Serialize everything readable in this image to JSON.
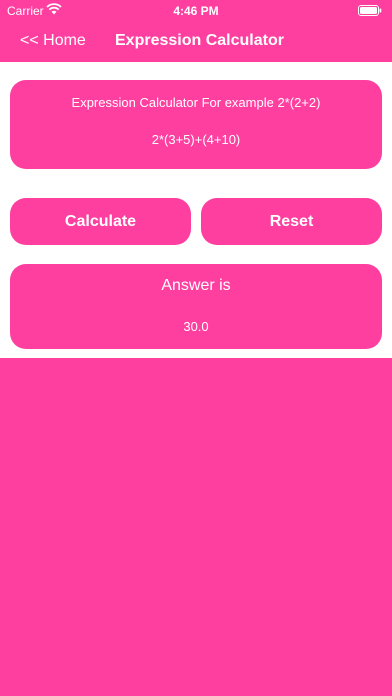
{
  "status_bar": {
    "carrier": "Carrier",
    "time": "4:46 PM"
  },
  "nav": {
    "back_label": "<< Home",
    "title": "Expression Calculator"
  },
  "input_card": {
    "prompt": "Expression Calculator For example 2*(2+2)",
    "expression_value": "2*(3+5)+(4+10)"
  },
  "buttons": {
    "calculate_label": "Calculate",
    "reset_label": "Reset"
  },
  "answer_card": {
    "heading": "Answer is",
    "value": "30.0"
  },
  "colors": {
    "accent": "#ff3fa0",
    "content_bg": "#ffffff",
    "text": "#ffffff"
  }
}
